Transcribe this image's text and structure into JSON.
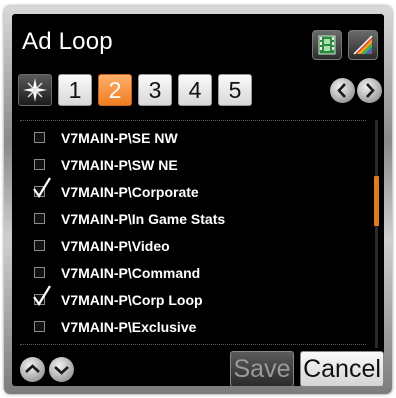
{
  "window": {
    "title": "Ad Loop"
  },
  "header_buttons": [
    {
      "icon": "film-strip-icon"
    },
    {
      "icon": "color-palette-icon"
    }
  ],
  "tabs": {
    "items": [
      "1",
      "2",
      "3",
      "4",
      "5"
    ],
    "active_index": 1,
    "all_icon": "starburst-icon"
  },
  "page_nav": {
    "prev_icon": "chevron-left-icon",
    "next_icon": "chevron-right-icon"
  },
  "list": {
    "items": [
      {
        "label": "V7MAIN-P\\SE NW",
        "checked": false
      },
      {
        "label": "V7MAIN-P\\SW NE",
        "checked": false
      },
      {
        "label": "V7MAIN-P\\Corporate",
        "checked": true
      },
      {
        "label": "V7MAIN-P\\In Game Stats",
        "checked": false
      },
      {
        "label": "V7MAIN-P\\Video",
        "checked": false
      },
      {
        "label": "V7MAIN-P\\Command",
        "checked": false
      },
      {
        "label": "V7MAIN-P\\Corp Loop",
        "checked": true
      },
      {
        "label": "V7MAIN-P\\Exclusive",
        "checked": false
      }
    ]
  },
  "footer": {
    "up_icon": "chevron-up-icon",
    "down_icon": "chevron-down-icon",
    "save_label": "Save",
    "cancel_label": "Cancel"
  },
  "colors": {
    "accent": "#f07d22",
    "background": "#000000",
    "text": "#ffffff"
  }
}
